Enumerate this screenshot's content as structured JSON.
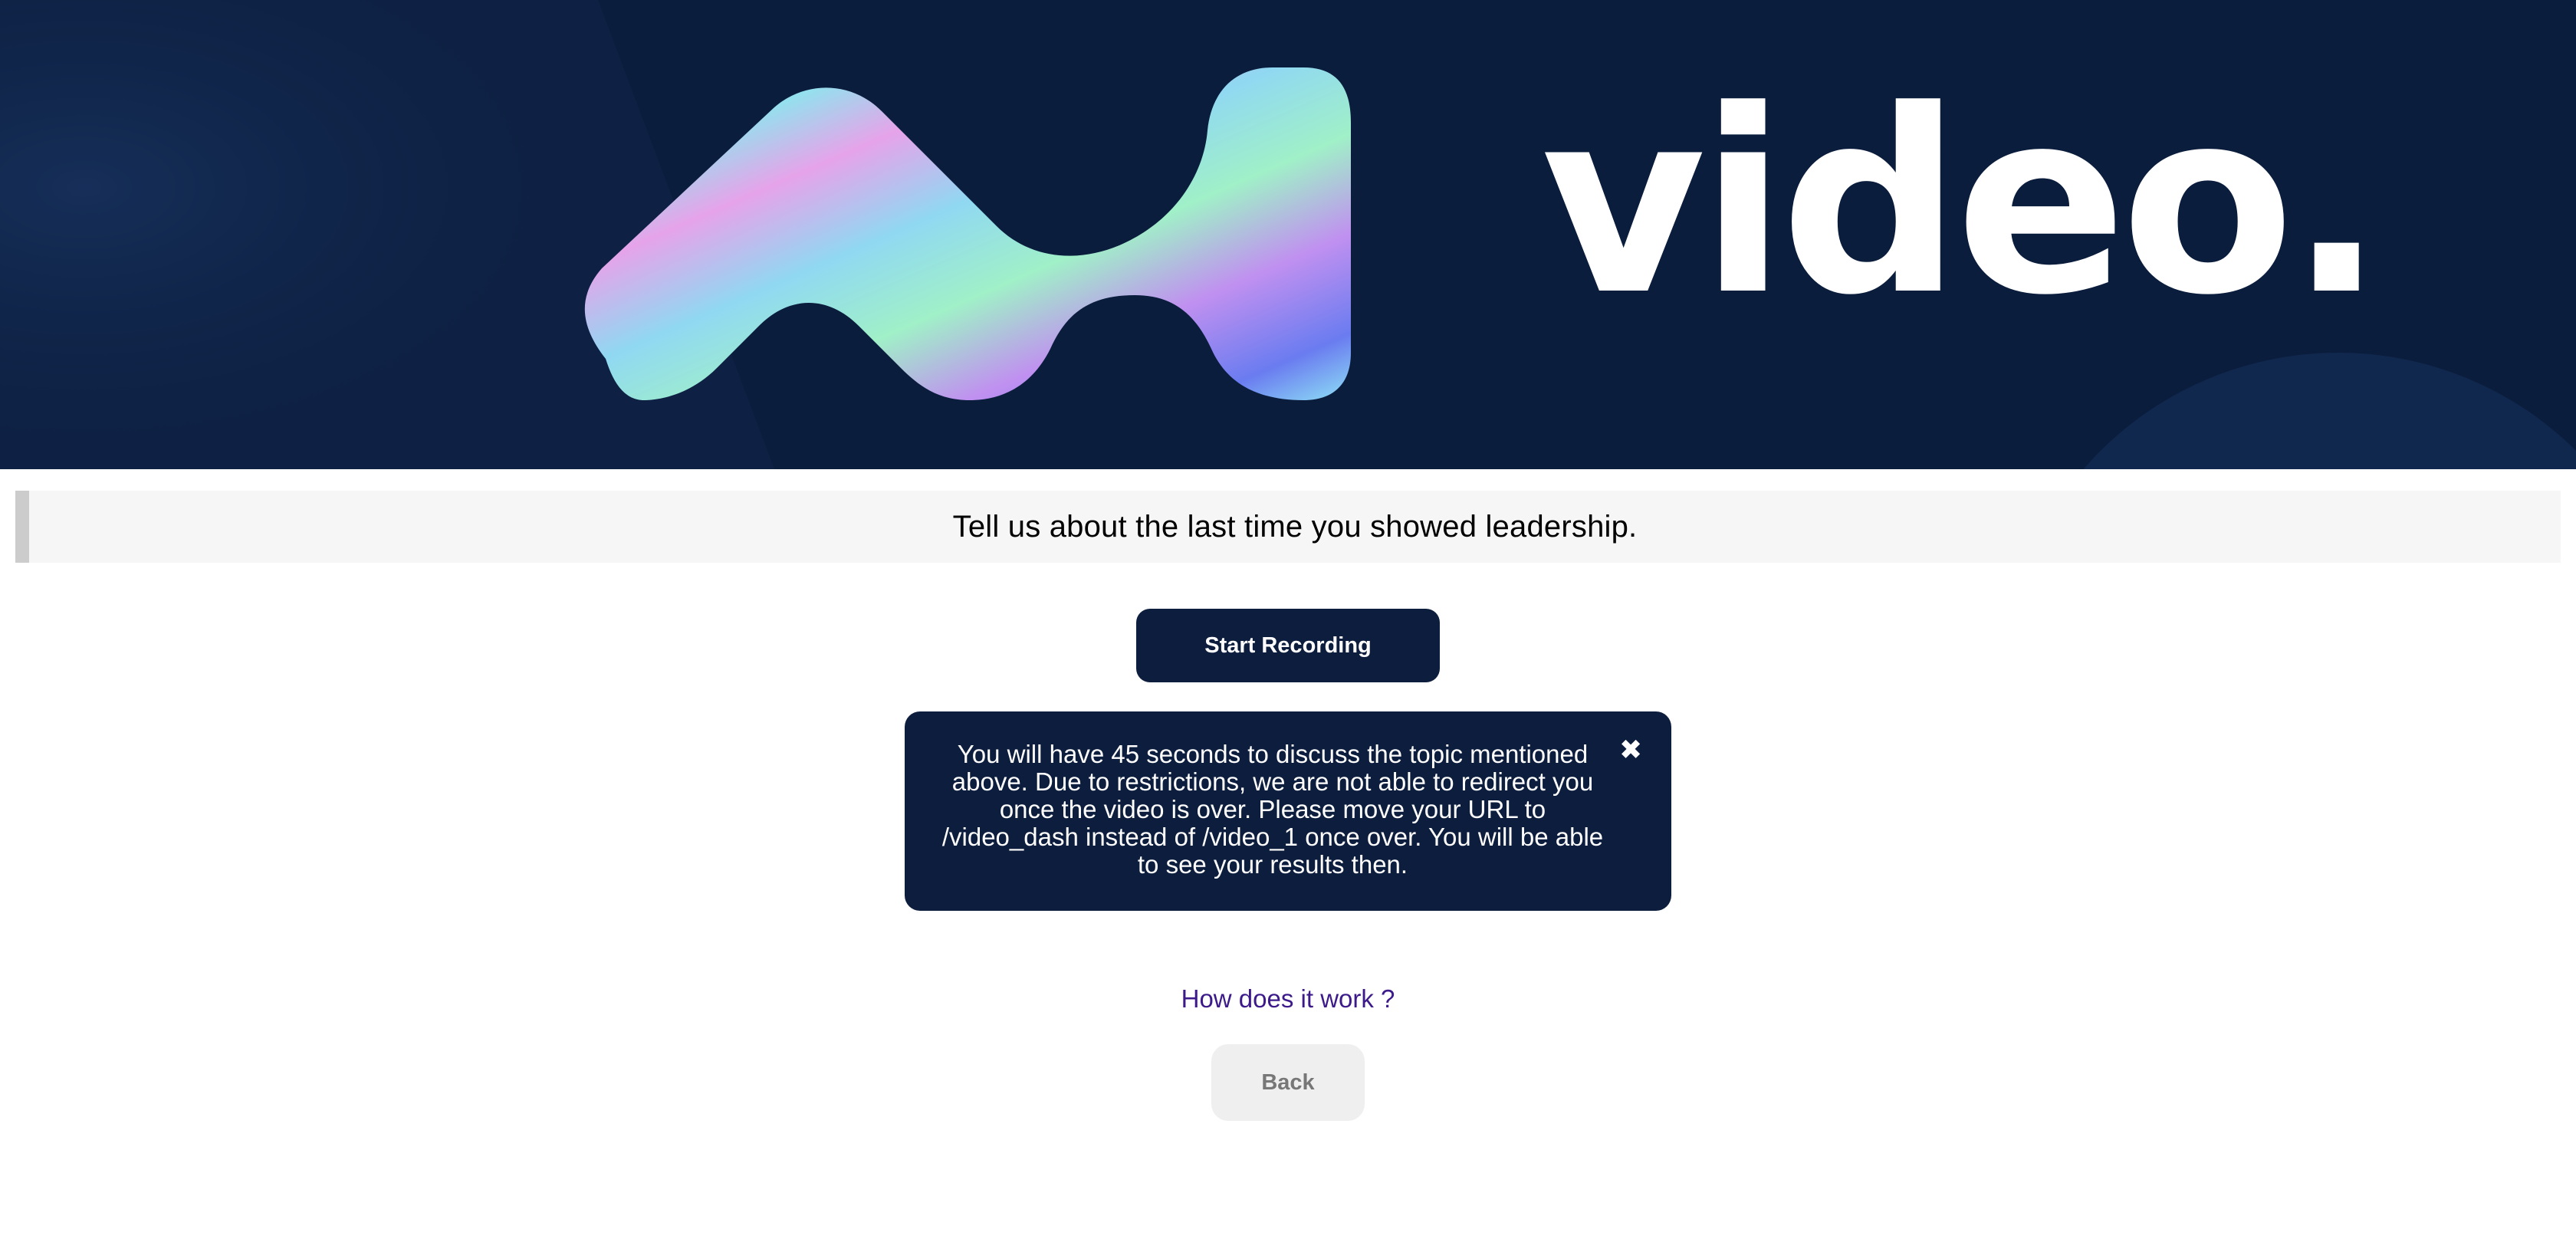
{
  "banner": {
    "wordmark": "video.",
    "logo_icon": "holographic-wave-logo",
    "background_color": "#0b1d3d"
  },
  "question": {
    "text": "Tell us about the last time you showed leadership."
  },
  "actions": {
    "start_recording_label": "Start Recording",
    "back_label": "Back",
    "accent_color": "#0c1d3d"
  },
  "info": {
    "message": "You will have 45 seconds to discuss the topic mentioned above. Due to restrictions, we are not able to redirect you once the video is over. Please move your URL to /video_dash instead of /video_1 once over. You will be able to see your results then.",
    "close_icon": "✖"
  },
  "help": {
    "link_label": "How does it work ?",
    "link_color": "#3c1a8a"
  }
}
